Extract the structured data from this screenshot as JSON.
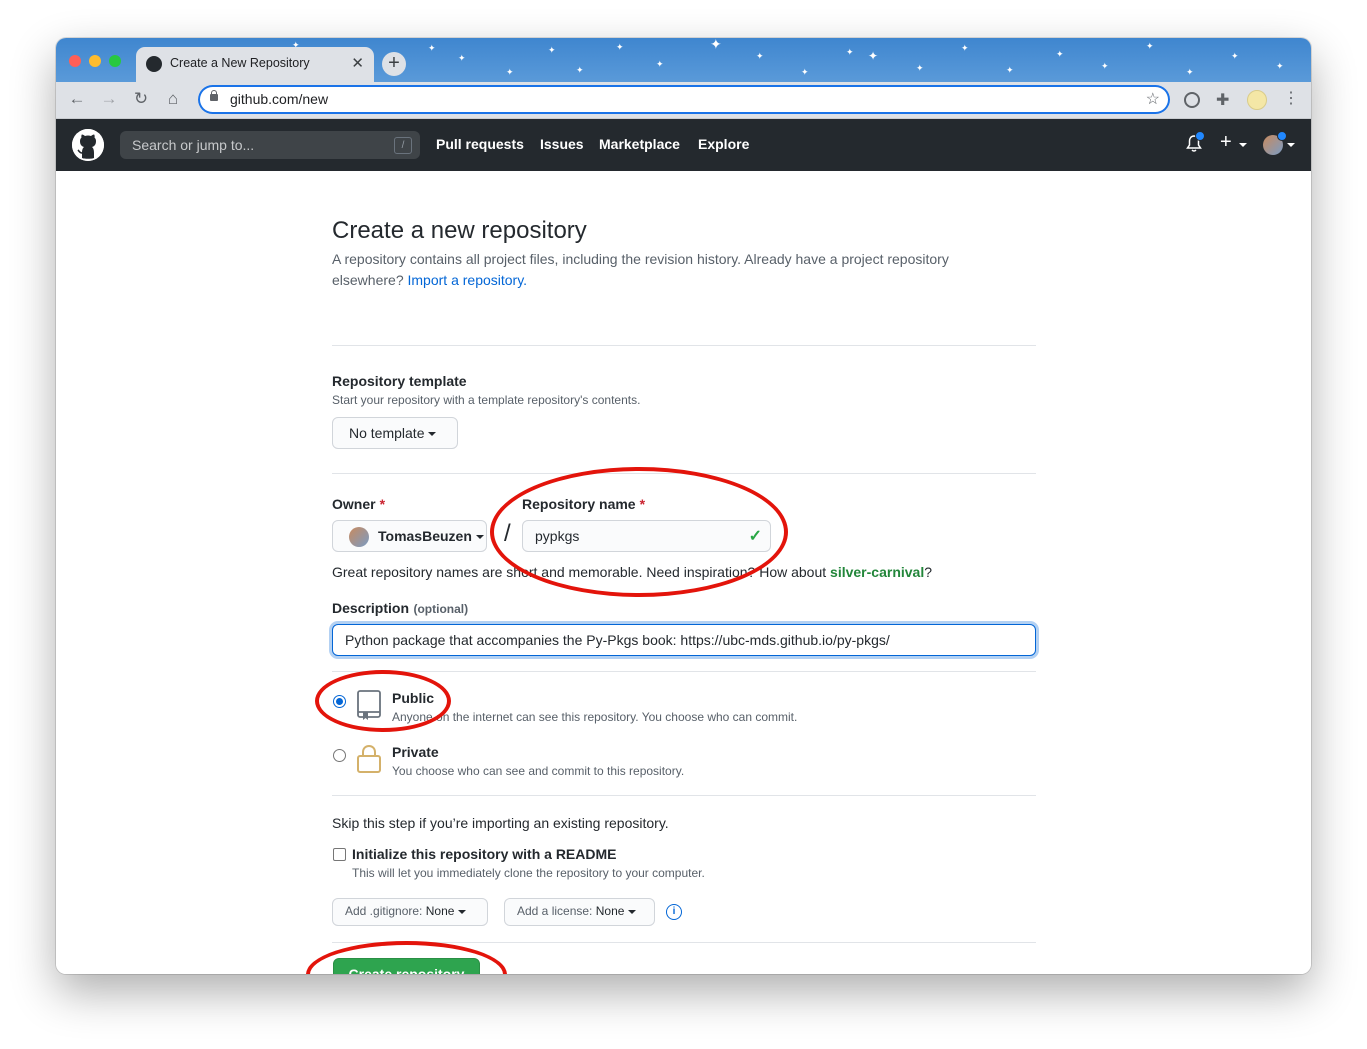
{
  "browser": {
    "tab_title": "Create a New Repository",
    "url": "github.com/new"
  },
  "header": {
    "search_placeholder": "Search or jump to...",
    "search_shortcut": "/",
    "nav_items": [
      "Pull requests",
      "Issues",
      "Marketplace",
      "Explore"
    ]
  },
  "page": {
    "title": "Create a new repository",
    "intro_line1": "A repository contains all project files, including the revision history. Already have a project repository",
    "intro_line2": "elsewhere?",
    "import_link": "Import a repository."
  },
  "template": {
    "heading": "Repository template",
    "subtext": "Start your repository with a template repository's contents.",
    "button": "No template"
  },
  "owner": {
    "label": "Owner",
    "required_mark": "*",
    "value": "TomasBeuzen"
  },
  "repo_name": {
    "separator": "/",
    "label": "Repository name",
    "required_mark": "*",
    "value": "pypkgs"
  },
  "name_hint": {
    "text": "Great repository names are short and memorable. Need inspiration? How about",
    "suggestion": "silver-carnival",
    "suffix": "?"
  },
  "description": {
    "label": "Description",
    "optional": "(optional)",
    "value": "Python package that accompanies the Py-Pkgs book: https://ubc-mds.github.io/py-pkgs/"
  },
  "visibility": {
    "public": {
      "title": "Public",
      "desc": "Anyone on the internet can see this repository. You choose who can commit.",
      "selected": true
    },
    "private": {
      "title": "Private",
      "desc": "You choose who can see and commit to this repository.",
      "selected": false
    }
  },
  "init": {
    "skip_note": "Skip this step if you’re importing an existing repository.",
    "readme_label": "Initialize this repository with a README",
    "readme_desc": "This will let you immediately clone the repository to your computer.",
    "readme_checked": false,
    "gitignore_prefix": "Add .gitignore:",
    "gitignore_value": "None",
    "license_prefix": "Add a license:",
    "license_value": "None"
  },
  "submit": {
    "label": "Create repository"
  },
  "colors": {
    "accent_green": "#2ea44f",
    "link_blue": "#0366d6",
    "annotation_red": "#e3140b",
    "header_dark": "#24292e"
  }
}
